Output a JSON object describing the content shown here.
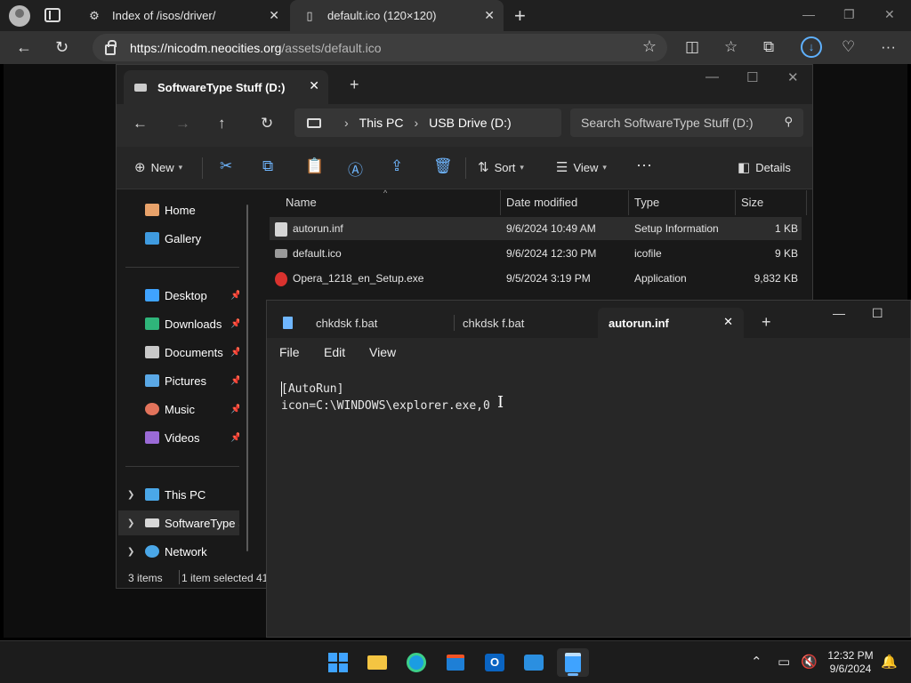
{
  "browser": {
    "tabs": [
      {
        "title": "Index of /isos/driver/",
        "icon": "settings-gear-icon"
      },
      {
        "title": "default.ico (120×120)",
        "icon": "page-icon"
      }
    ],
    "url_host": "https://nicodm.neocities.org",
    "url_path": "/assets/default.ico"
  },
  "explorer": {
    "window_title": "SoftwareType Stuff (D:)",
    "breadcrumb": [
      "This PC",
      "USB Drive (D:)"
    ],
    "search_placeholder": "Search SoftwareType Stuff (D:)",
    "commands": {
      "new": "New",
      "sort": "Sort",
      "view": "View",
      "details": "Details"
    },
    "sidebar": {
      "home": "Home",
      "gallery": "Gallery",
      "quick": [
        "Desktop",
        "Downloads",
        "Documents",
        "Pictures",
        "Music",
        "Videos"
      ],
      "this_pc": "This PC",
      "drive": "SoftwareType Stuff (D:)",
      "network": "Network"
    },
    "columns": [
      "Name",
      "Date modified",
      "Type",
      "Size"
    ],
    "files": [
      {
        "name": "autorun.inf",
        "date": "9/6/2024 10:49 AM",
        "type": "Setup Information",
        "size": "1 KB"
      },
      {
        "name": "default.ico",
        "date": "9/6/2024 12:30 PM",
        "type": "icofile",
        "size": "9 KB"
      },
      {
        "name": "Opera_1218_en_Setup.exe",
        "date": "9/5/2024 3:19 PM",
        "type": "Application",
        "size": "9,832 KB"
      }
    ],
    "status": {
      "count": "3 items",
      "selected": "1 item selected",
      "extra": "41"
    }
  },
  "notepad": {
    "tabs": [
      "chkdsk f.bat",
      "chkdsk f.bat",
      "autorun.inf"
    ],
    "menu": [
      "File",
      "Edit",
      "View"
    ],
    "lines": [
      "[AutoRun]",
      "icon=C:\\WINDOWS\\explorer.exe,0"
    ]
  },
  "taskbar": {
    "time": "12:32 PM",
    "date": "9/6/2024"
  },
  "colors": {
    "accent": "#3fa3ff"
  }
}
